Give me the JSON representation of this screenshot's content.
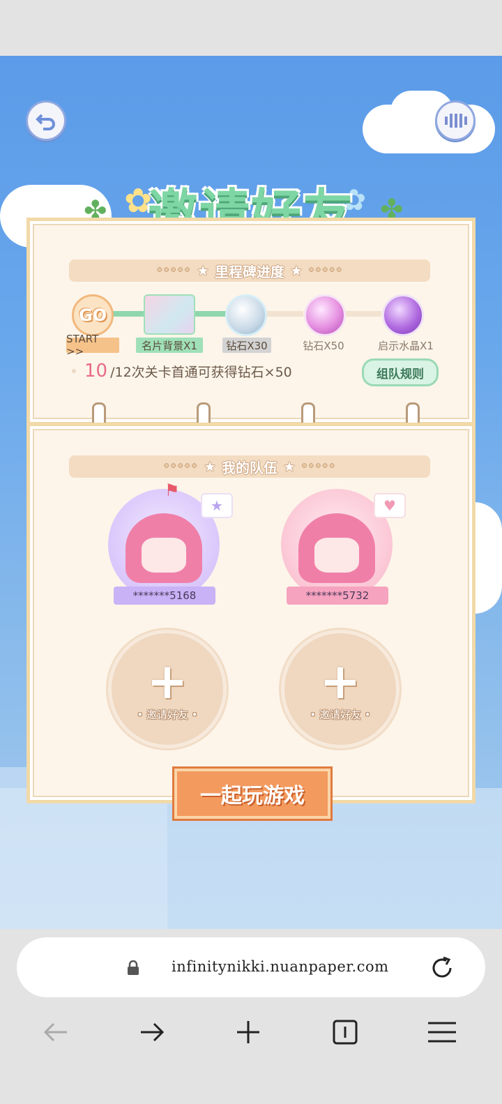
{
  "title": "邀请好友",
  "milestone": {
    "header": "里程碑进度",
    "go_label": "GO",
    "rewards": [
      {
        "label": "START >>",
        "tag_color": "#f5c28a"
      },
      {
        "label": "名片背景X1",
        "tag_color": "#9fe0b8"
      },
      {
        "label": "钻石X30",
        "tag_color": "#d3d3d3"
      },
      {
        "label": "钻石X50",
        "tag_color": "transparent"
      },
      {
        "label": "启示水晶X1",
        "tag_color": "transparent"
      }
    ],
    "progress_count": "10",
    "progress_text": "/12次关卡首通可获得钻石×50",
    "rules_button": "组队规则"
  },
  "team": {
    "header": "我的队伍",
    "members": [
      {
        "name": "*******5168",
        "badge_icon": "star-icon"
      },
      {
        "name": "*******5732",
        "badge_icon": "heart-icon"
      }
    ],
    "invite_slots": [
      {
        "label": "• 邀请好友 •"
      },
      {
        "label": "• 邀请好友 •"
      }
    ]
  },
  "play_button": "一起玩游戏",
  "browser": {
    "url": "infinitynikki.nuanpaper.com"
  }
}
